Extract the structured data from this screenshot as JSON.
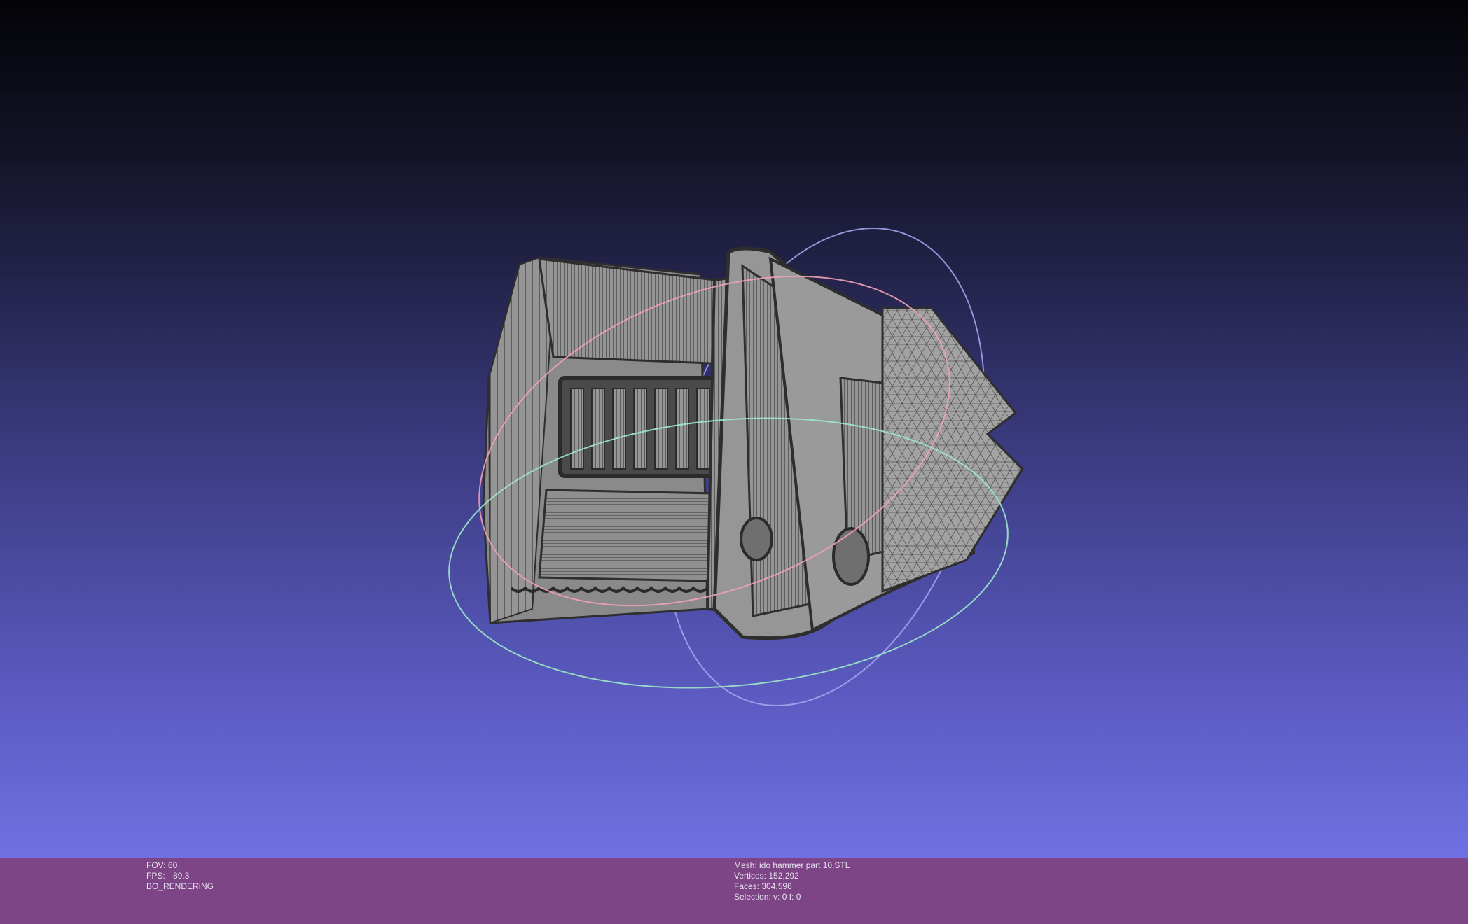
{
  "viewport": {
    "background_top": "#030307",
    "background_bottom": "#7070e2",
    "mesh_color": "#8e8e8e",
    "wire_color": "#3a3a3a",
    "trackball_colors": {
      "x_ring": "#f0a0b4",
      "y_ring": "#9ee8c8",
      "z_ring": "#a8a8f0"
    }
  },
  "info_bar": {
    "background": "#7d4486",
    "left": {
      "fov_label": "FOV:",
      "fov_value": "60",
      "fps_label": "FPS:",
      "fps_value": "89.3",
      "render_mode": "BO_RENDERING"
    },
    "right": {
      "mesh_line": "Mesh: ido hammer part 10.STL",
      "vertices_line": "Vertices: 152,292",
      "faces_line": "Faces: 304,596",
      "selection_line": "Selection: v: 0 f: 0"
    }
  }
}
